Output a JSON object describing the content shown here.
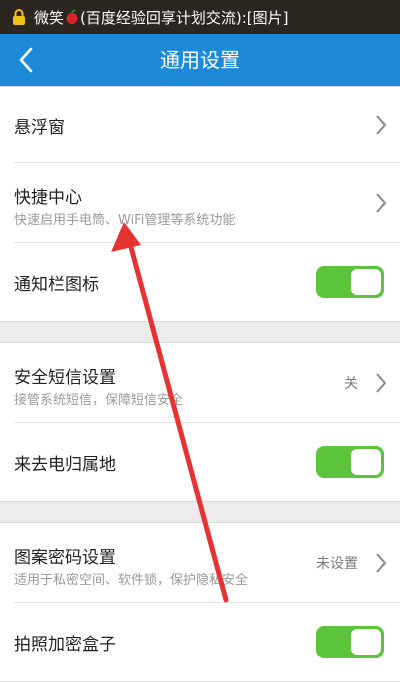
{
  "status_bar": {
    "prefix": "微笑",
    "suffix": "(百度经验回享计划交流):[图片]",
    "apple_icon": "apple-emoji",
    "app_icon": "lock-icon"
  },
  "header": {
    "title": "通用设置",
    "back_icon": "back-arrow-icon"
  },
  "colors": {
    "header": "#1c8ad8",
    "toggle_on": "#5cc43b",
    "annotation_arrow": "#e63232"
  },
  "settings": {
    "floating_window": {
      "title": "悬浮窗"
    },
    "shortcut_center": {
      "title": "快捷中心",
      "subtitle": "快速启用手电筒、WiFi管理等系统功能"
    },
    "notification_icon": {
      "title": "通知栏图标",
      "enabled": true
    },
    "secure_sms": {
      "title": "安全短信设置",
      "subtitle": "接管系统短信，保障短信安全",
      "value": "关"
    },
    "caller_location": {
      "title": "来去电归属地",
      "enabled": true
    },
    "pattern_password": {
      "title": "图案密码设置",
      "subtitle": "适用于私密空间、软件锁，保护隐私安全",
      "value": "未设置"
    },
    "photo_encrypt_box": {
      "title": "拍照加密盒子",
      "enabled": true
    }
  }
}
